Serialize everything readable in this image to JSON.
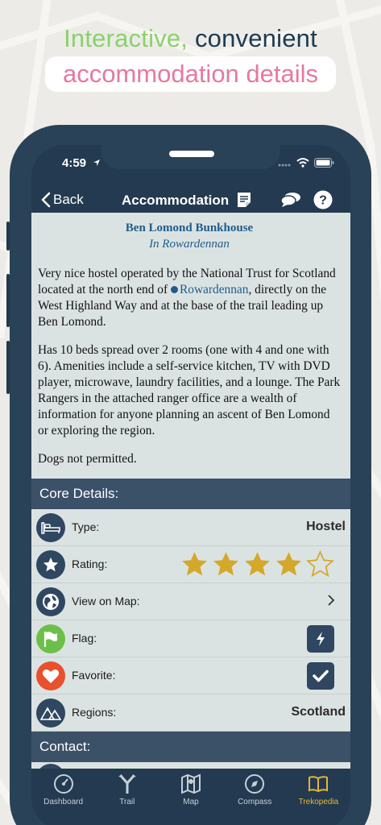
{
  "headline": {
    "line1_accent": "Interactive,",
    "line1_rest": "convenient",
    "line2": "accommodation details"
  },
  "status": {
    "time": "4:59"
  },
  "nav": {
    "back_label": "Back",
    "title": "Accommodation",
    "icons": [
      "notes-icon",
      "chat-icon",
      "help-icon"
    ]
  },
  "article": {
    "title": "Ben Lomond Bunkhouse",
    "subtitle": "In Rowardennan",
    "p1_before": "Very nice hostel operated by the National Trust for Scotland located at the north end of",
    "p1_link": "Rowardennan",
    "p1_after": ", directly on the West Highland Way and at the base of the trail leading up Ben Lomond.",
    "p2": "Has 10 beds spread over 2 rooms (one with 4 and one with 6). Amenities include a self-service kitchen, TV with DVD player, microwave, laundry facilities, and a lounge. The Park Rangers in the attached ranger office are a wealth of information for anyone planning an ascent of Ben Lomond or exploring the region.",
    "p3": "Dogs not permitted."
  },
  "core": {
    "header": "Core Details:",
    "type_label": "Type:",
    "type_value": "Hostel",
    "rating_label": "Rating:",
    "rating_value": 4,
    "rating_max": 5,
    "map_label": "View on Map:",
    "flag_label": "Flag:",
    "favorite_label": "Favorite:",
    "regions_label": "Regions:",
    "regions_value": "Scotland"
  },
  "contact": {
    "header": "Contact:"
  },
  "tabs": [
    {
      "label": "Dashboard",
      "icon": "dashboard-icon"
    },
    {
      "label": "Trail",
      "icon": "trail-icon"
    },
    {
      "label": "Map",
      "icon": "map-icon"
    },
    {
      "label": "Compass",
      "icon": "compass-icon"
    },
    {
      "label": "Trekopedia",
      "icon": "book-icon",
      "active": true
    }
  ],
  "colors": {
    "accent_green": "#8bd16a",
    "accent_pink": "#e8789c",
    "navy": "#233a50",
    "star_gold": "#d4a82a",
    "link_blue": "#1f5c8c"
  }
}
